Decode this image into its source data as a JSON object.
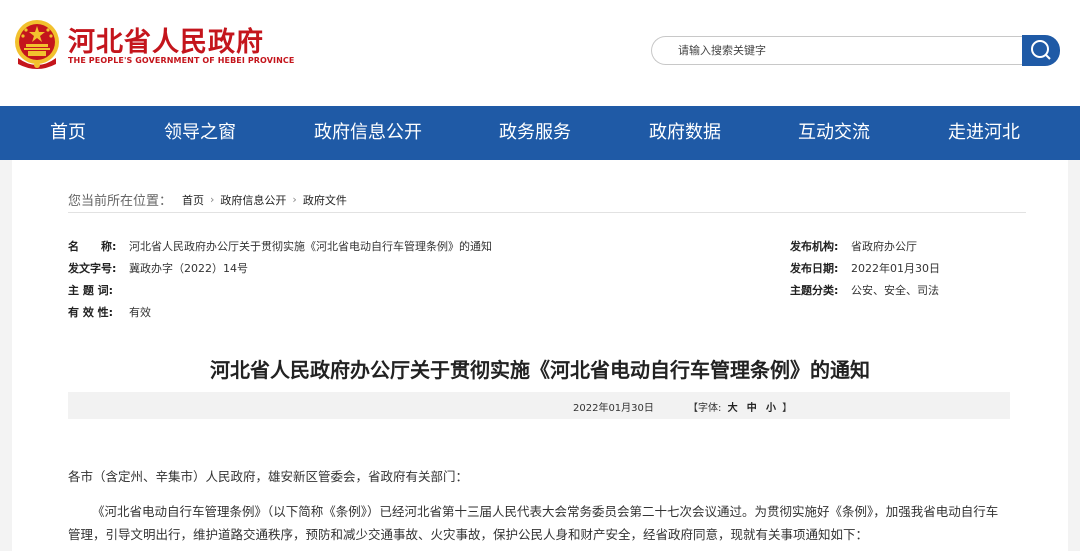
{
  "header": {
    "title": "河北省人民政府",
    "subtitle": "THE PEOPLE'S GOVERNMENT OF HEBEI PROVINCE",
    "emblem_colors": {
      "red": "#c4151c",
      "gold": "#f2c12e"
    }
  },
  "search": {
    "placeholder": "请输入搜索关键字",
    "button_icon": "search-icon"
  },
  "nav": {
    "items": [
      {
        "label": "首页"
      },
      {
        "label": "领导之窗"
      },
      {
        "label": "政府信息公开"
      },
      {
        "label": "政务服务"
      },
      {
        "label": "政府数据"
      },
      {
        "label": "互动交流"
      },
      {
        "label": "走进河北"
      }
    ],
    "color": "#1f5aa6"
  },
  "breadcrumb": {
    "lead": "您当前所在位置：",
    "items": [
      {
        "label": "首页"
      },
      {
        "label": "政府信息公开"
      },
      {
        "label": "政府文件"
      }
    ]
  },
  "meta": {
    "name_label": "名　　称:",
    "name_value": "河北省人民政府办公厅关于贯彻实施《河北省电动自行车管理条例》的通知",
    "docno_label": "发文字号:",
    "docno_value": "冀政办字（2022）14号",
    "subject_label": "主 题 词:",
    "validity_label": "有 效 性:",
    "validity_value": "有效",
    "issuer_label": "发布机构:",
    "issuer_value": "省政府办公厅",
    "date_label": "发布日期:",
    "date_value": "2022年01月30日",
    "category_label": "主题分类:",
    "category_value": "公安、安全、司法"
  },
  "document": {
    "title": "河北省人民政府办公厅关于贯彻实施《河北省电动自行车管理条例》的通知",
    "date": "2022年01月30日",
    "font_label_open": "【字体:",
    "font_sizes": [
      "大",
      "中",
      "小"
    ],
    "font_label_close": "】",
    "addressee": "各市（含定州、辛集市）人民政府，雄安新区管委会，省政府有关部门：",
    "paragraph_line1": "《河北省电动自行车管理条例》（以下简称《条例》）已经河北省第十三届人民代表大会常务委员会第二十七次会议通过。为贯彻实施好《条例》，加强我省电动自行车",
    "paragraph_line2": "管理，引导文明出行，维护道路交通秩序，预防和减少交通事故、火灾事故，保护公民人身和财产安全，经省政府同意，现就有关事项通知如下："
  }
}
